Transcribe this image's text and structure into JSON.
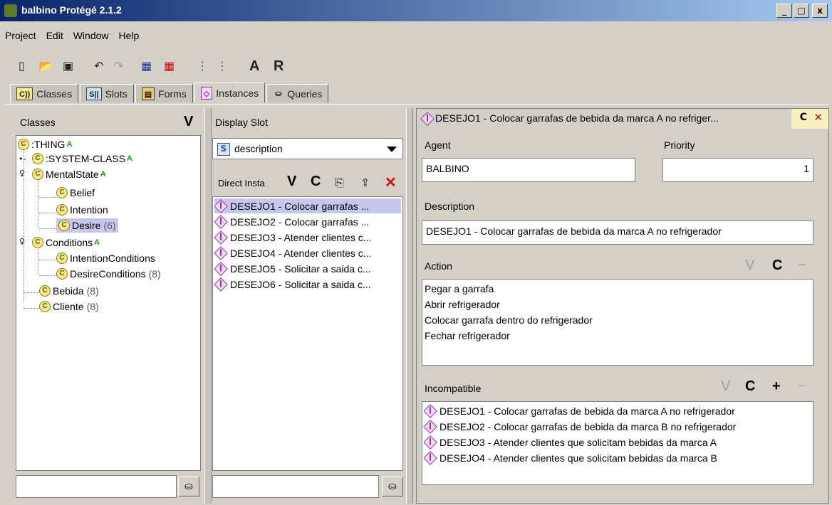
{
  "window": {
    "title": "balbino  Protégé 2.1.2",
    "controls": [
      "_",
      "□",
      "x"
    ]
  },
  "menu": [
    "Project",
    "Edit",
    "Window",
    "Help"
  ],
  "toolbar": {
    "letter_a": "A",
    "letter_r": "R"
  },
  "tabs": [
    {
      "icon": "C))",
      "label": "Classes"
    },
    {
      "icon": "S||",
      "label": "Slots"
    },
    {
      "icon": "▤",
      "label": "Forms"
    },
    {
      "icon": "◇",
      "label": "Instances"
    },
    {
      "icon": "⛀",
      "label": "Queries"
    }
  ],
  "classes_pane": {
    "title": "Classes",
    "v_button": "V",
    "tree": [
      {
        "label": ":THING",
        "flag": "A",
        "count": ""
      },
      {
        "label": ":SYSTEM-CLASS",
        "flag": "A",
        "count": ""
      },
      {
        "label": "MentalState",
        "flag": "A",
        "count": ""
      },
      {
        "label": "Belief",
        "flag": "",
        "count": ""
      },
      {
        "label": "Intention",
        "flag": "",
        "count": ""
      },
      {
        "label": "Desire",
        "flag": "",
        "count": "(6)"
      },
      {
        "label": "Conditions",
        "flag": "A",
        "count": ""
      },
      {
        "label": "IntentionConditions",
        "flag": "",
        "count": ""
      },
      {
        "label": "DesireConditions",
        "flag": "",
        "count": "(8)"
      },
      {
        "label": "Bebida",
        "flag": "",
        "count": "(8)"
      },
      {
        "label": "Cliente",
        "flag": "",
        "count": "(8)"
      }
    ]
  },
  "instances_pane": {
    "display_slot_label": "Display Slot",
    "display_slot_value": "description",
    "direct_label": "Direct Insta",
    "buttons": {
      "v": "V",
      "c": "C",
      "delete": "✕"
    },
    "items": [
      "DESEJO1 - Colocar garrafas ...",
      "DESEJO2 - Colocar garrafas ...",
      "DESEJO3 - Atender clientes c...",
      "DESEJO4 - Atender clientes c...",
      "DESEJO5 - Solicitar a saida c...",
      "DESEJO6 - Solicitar a saida c..."
    ]
  },
  "form": {
    "header": "DESEJO1 - Colocar garrafas de bebida da marca A no refriger...",
    "header_c": "C",
    "header_x": "✕",
    "agent_label": "Agent",
    "agent_value": "BALBINO",
    "priority_label": "Priority",
    "priority_value": "1",
    "description_label": "Description",
    "description_value": "DESEJO1 - Colocar garrafas de bebida da marca A no refrigerador",
    "action_label": "Action",
    "action_buttons": {
      "v": "V",
      "c": "C",
      "minus": "−"
    },
    "action_lines": [
      "Pegar a garrafa",
      "Abrir refrigerador",
      "Colocar garrafa dentro do refrigerador",
      "Fechar refrigerador"
    ],
    "incompatible_label": "Incompatible",
    "incompatible_buttons": {
      "v": "V",
      "c": "C",
      "plus": "+",
      "minus": "−"
    },
    "incompatible_items": [
      "DESEJO1 - Colocar garrafas de bebida da marca A no refrigerador",
      "DESEJO2 - Colocar garrafas de bebida da marca B no refrigerador",
      "DESEJO3 - Atender clientes que solicitam bebidas da marca A",
      "DESEJO4 - Atender clientes que solicitam bebidas da marca B"
    ]
  }
}
